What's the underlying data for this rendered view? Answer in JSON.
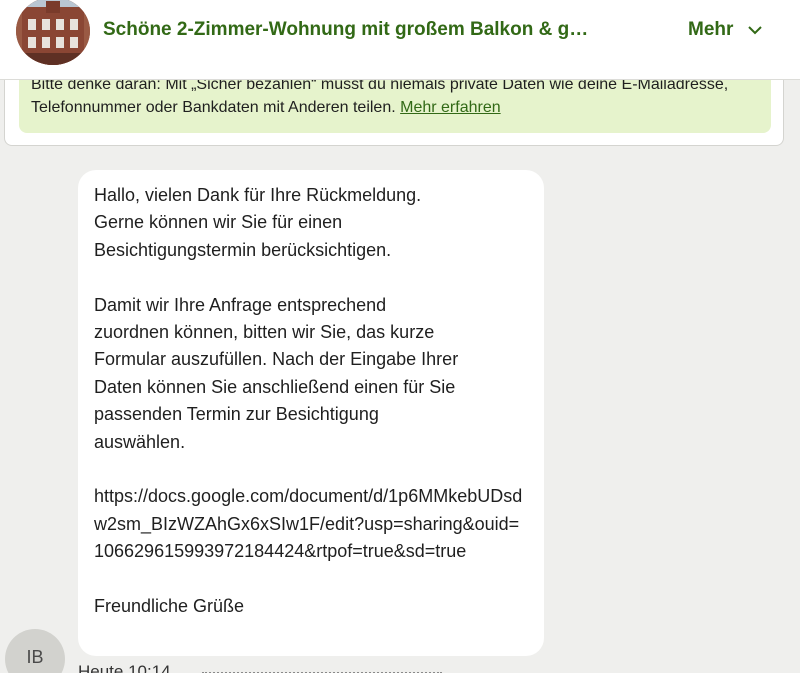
{
  "header": {
    "title": "Schöne 2-Zimmer-Wohnung mit großem Balkon & g…",
    "more_label": "Mehr"
  },
  "notice": {
    "text": "Bitte denke daran: Mit „Sicher bezahlen“ musst du niemals private Daten wie deine E-Mailadresse, Telefonnummer oder Bankdaten mit Anderen teilen.",
    "link_label": "Mehr erfahren"
  },
  "message": {
    "paragraph1": "Hallo, vielen Dank für Ihre Rückmeldung.\nGerne können wir Sie für einen\nBesichtigungstermin berücksichtigen.",
    "paragraph2": "Damit wir Ihre Anfrage entsprechend\nzuordnen können, bitten wir Sie, das kurze\nFormular auszufüllen. Nach der Eingabe Ihrer\nDaten können Sie anschließend einen für Sie\npassenden Termin zur Besichtigung\nauswählen.",
    "link": "https://docs.google.com/document/d/1p6MMkebUDsdw2sm_BIzWZAhGx6xSIw1F/edit?usp=sharing&ouid=106629615993972184424&rtpof=true&sd=true",
    "closing": "Freundliche Grüße"
  },
  "sender": {
    "initials": "IB",
    "timestamp": "Heute 10:14"
  },
  "colors": {
    "brand_green": "#326916",
    "notice_bg": "#e6f3cc",
    "page_bg": "#efefed"
  }
}
